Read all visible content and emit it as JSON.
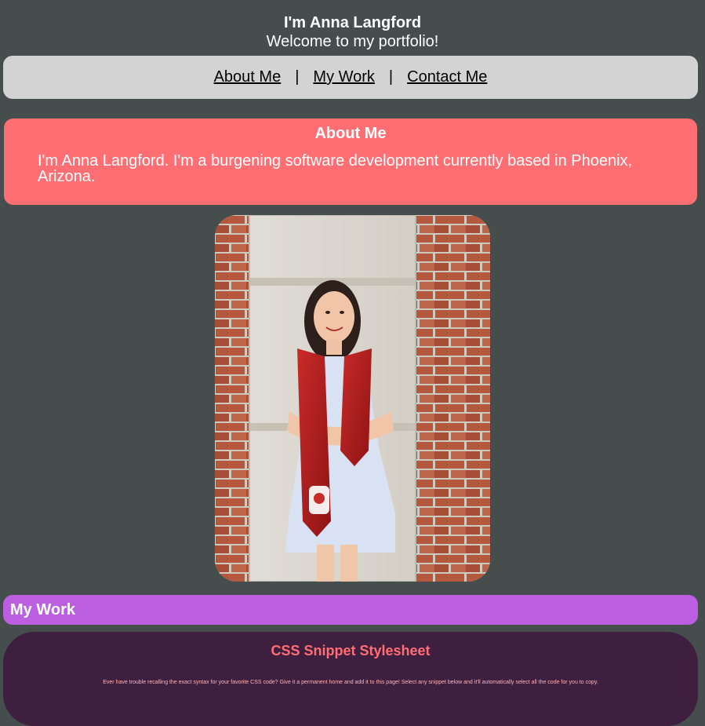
{
  "header": {
    "title": "I'm Anna Langford",
    "subtitle": "Welcome to my portfolio!"
  },
  "nav": {
    "items": [
      {
        "label": "About Me"
      },
      {
        "label": "My Work"
      },
      {
        "label": "Contact Me"
      }
    ],
    "separator": "|"
  },
  "about": {
    "heading": "About Me",
    "body": "I'm Anna Langford. I'm a burgening software development currently based in Phoenix, Arizona."
  },
  "photo": {
    "description": "graduation-portrait"
  },
  "work": {
    "heading": "My Work",
    "project": {
      "title": "CSS Snippet Stylesheet",
      "description": "Ever have trouble recalling the exact syntax for your favorite CSS code? Give it a permanent home and add it to this page! Select any snippet below and it'll automatically select all the code for you to copy."
    }
  },
  "colors": {
    "background": "#454d4d",
    "nav_bg": "#d3d3d3",
    "about_bg": "#ff6e73",
    "work_bg": "#bb5fe0",
    "card_bg": "#3e1f3f",
    "card_title": "#ff6e73"
  }
}
